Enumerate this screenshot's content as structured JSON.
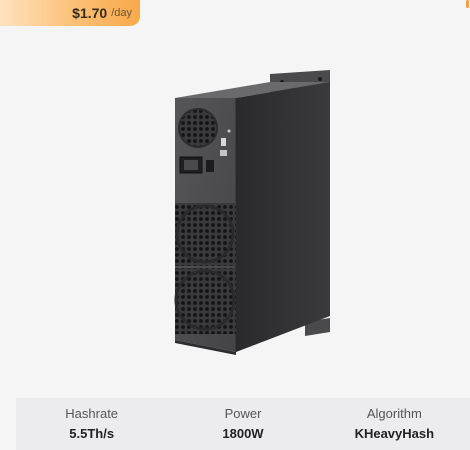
{
  "price": {
    "value": "$1.70",
    "unit": "/day"
  },
  "product_image": {
    "icon": "asic-miner-image"
  },
  "specs": [
    {
      "label": "Hashrate",
      "value": "5.5Th/s"
    },
    {
      "label": "Power",
      "value": "1800W"
    },
    {
      "label": "Algorithm",
      "value": "KHeavyHash"
    }
  ],
  "colors": {
    "badge_start": "#fde2be",
    "badge_end": "#f9a94a",
    "background": "#f5f5f6",
    "spec_bar": "#ececee"
  }
}
